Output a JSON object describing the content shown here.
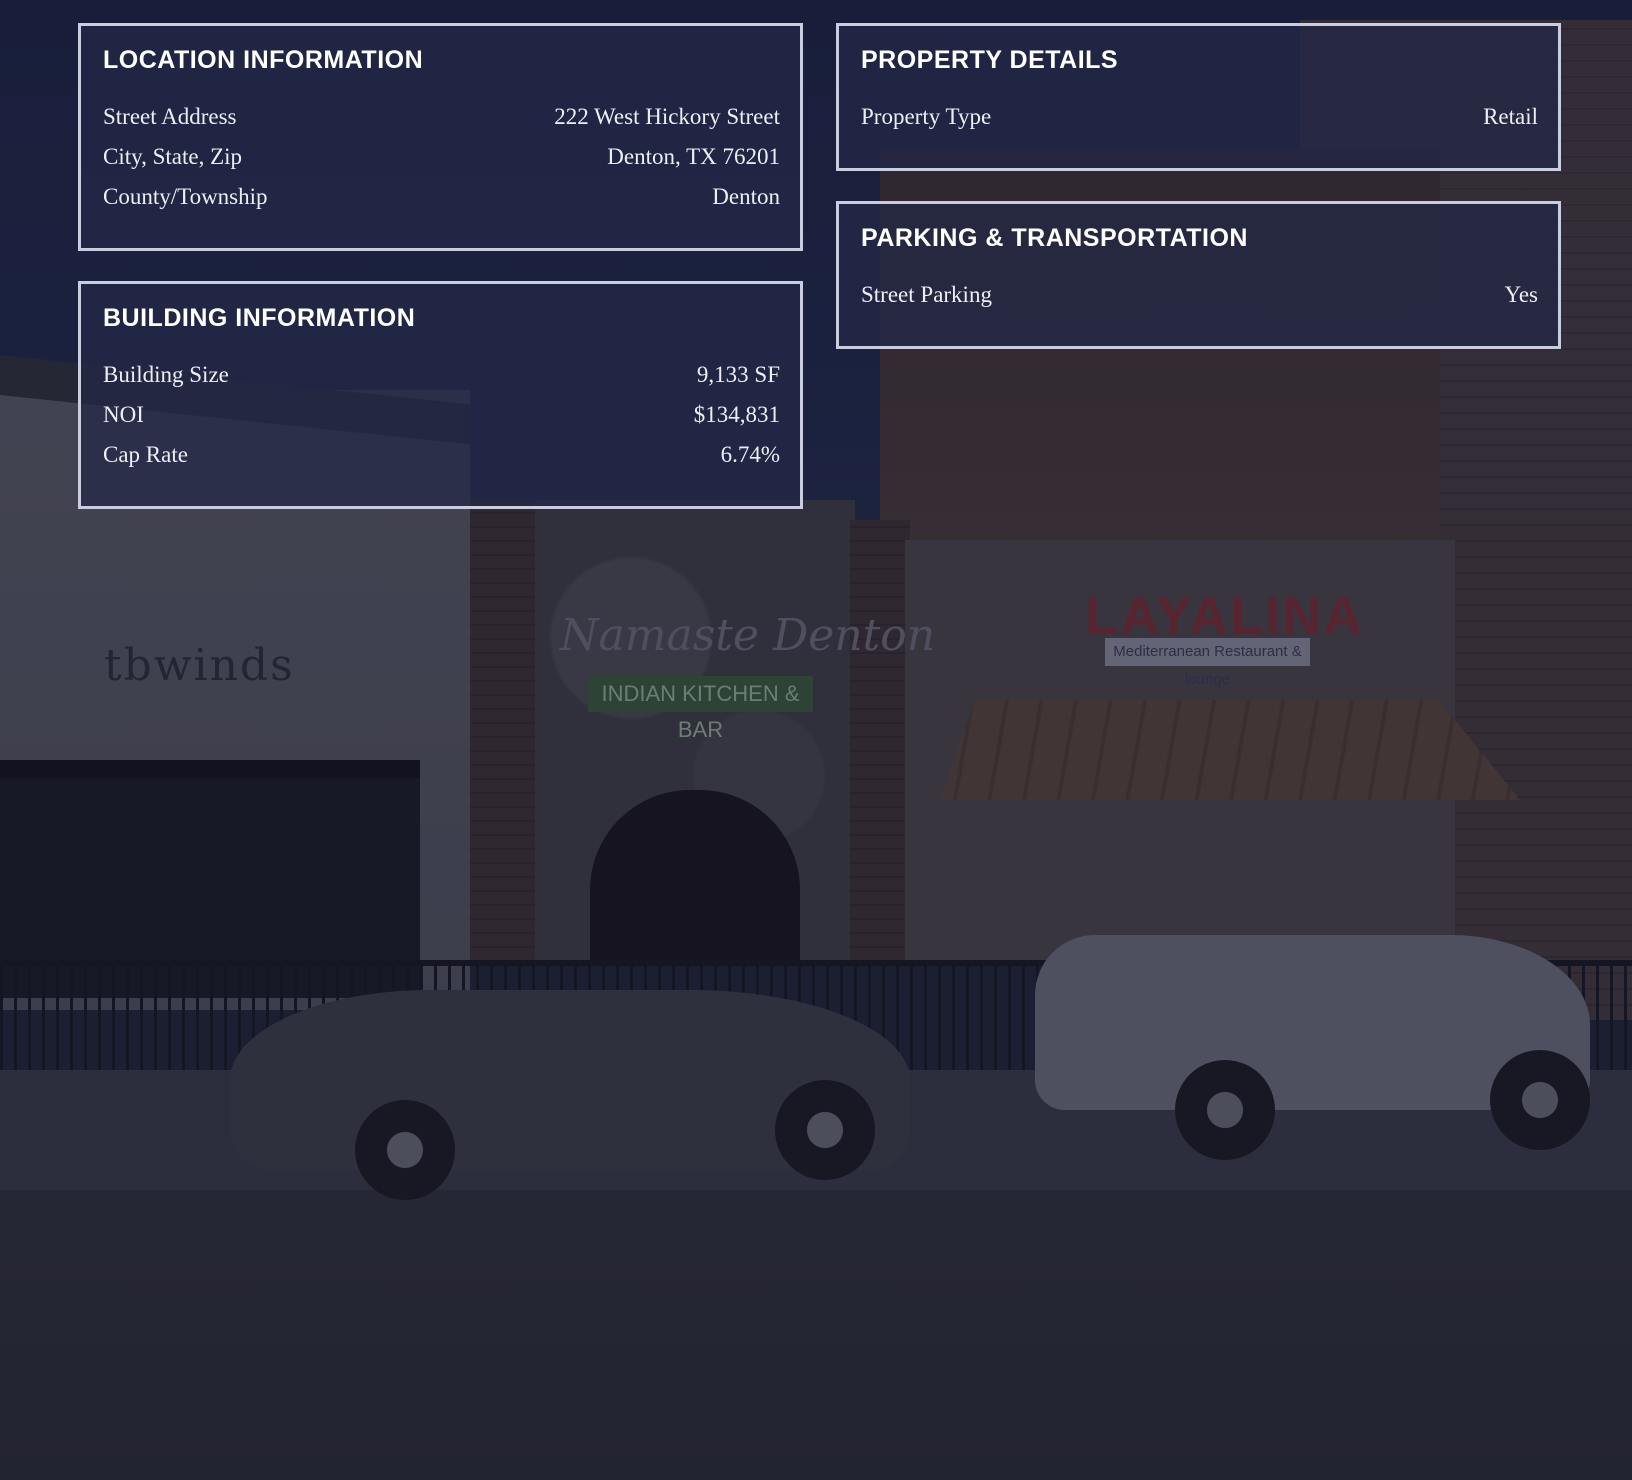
{
  "backdrop": {
    "signs": {
      "tbwinds": "tbwinds",
      "namaste": "Namaste Denton",
      "namaste_sub": "INDIAN KITCHEN & BAR",
      "layalina": "LAYALINA",
      "layalina_sub": "Mediterranean Restaurant & lounge"
    }
  },
  "location": {
    "title": "LOCATION INFORMATION",
    "rows": [
      {
        "label": "Street Address",
        "value": "222 West Hickory Street"
      },
      {
        "label": "City, State, Zip",
        "value": "Denton, TX 76201"
      },
      {
        "label": "County/Township",
        "value": "Denton"
      }
    ]
  },
  "building": {
    "title": "BUILDING INFORMATION",
    "rows": [
      {
        "label": "Building Size",
        "value": "9,133 SF"
      },
      {
        "label": "NOI",
        "value": "$134,831"
      },
      {
        "label": "Cap Rate",
        "value": "6.74%"
      }
    ]
  },
  "property": {
    "title": "PROPERTY DETAILS",
    "rows": [
      {
        "label": "Property Type",
        "value": "Retail"
      }
    ]
  },
  "parking": {
    "title": "PARKING & TRANSPORTATION",
    "rows": [
      {
        "label": "Street Parking",
        "value": "Yes"
      }
    ]
  },
  "colors": {
    "panel_border": "#c9cde0",
    "panel_background": "#222846",
    "text": "#f1f2f6"
  }
}
